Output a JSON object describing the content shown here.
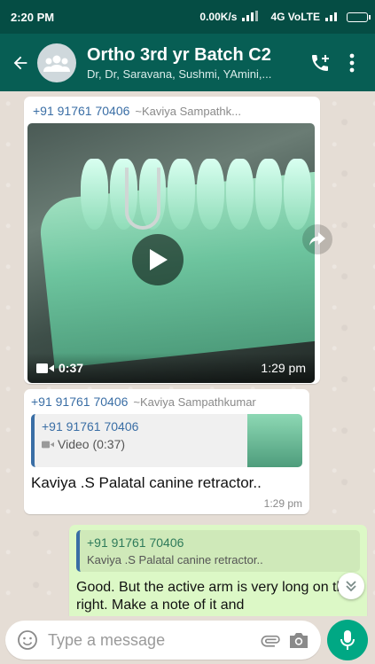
{
  "status_bar": {
    "time": "2:20 PM",
    "network_speed": "0.00K/s",
    "network": "4G VoLTE"
  },
  "header": {
    "title": "Ortho 3rd yr Batch C2",
    "subtitle": "Dr, Dr, Saravana, Sushmi, YAmini,..."
  },
  "messages": [
    {
      "sender_phone": "+91 91761 70406",
      "sender_name": "~Kaviya Sampathk...",
      "duration": "0:37",
      "time": "1:29 pm"
    },
    {
      "sender_phone": "+91 91761 70406",
      "sender_name": "~Kaviya Sampathkumar",
      "quote_sender": "+91 91761 70406",
      "quote_desc": "Video (0:37)",
      "text": "Kaviya .S  Palatal canine retractor..",
      "time": "1:29 pm"
    },
    {
      "quote_sender": "+91 91761 70406",
      "quote_desc": "Kaviya .S  Palatal canine retractor..",
      "text": "Good. But the active arm is very long on the right. Make a note of it and"
    }
  ],
  "composer": {
    "placeholder": "Type a message"
  },
  "colors": {
    "header": "#075e54",
    "status": "#054d44",
    "outgoing": "#dcf8c6",
    "accent": "#00a884",
    "sender": "#3a6ea5"
  },
  "icons": {
    "back": "arrow-left-icon",
    "call": "add-call-icon",
    "menu": "kebab-menu-icon",
    "play": "play-icon",
    "forward": "forward-icon",
    "emoji": "emoji-icon",
    "attach": "paperclip-icon",
    "camera": "camera-icon",
    "mic": "microphone-icon"
  }
}
